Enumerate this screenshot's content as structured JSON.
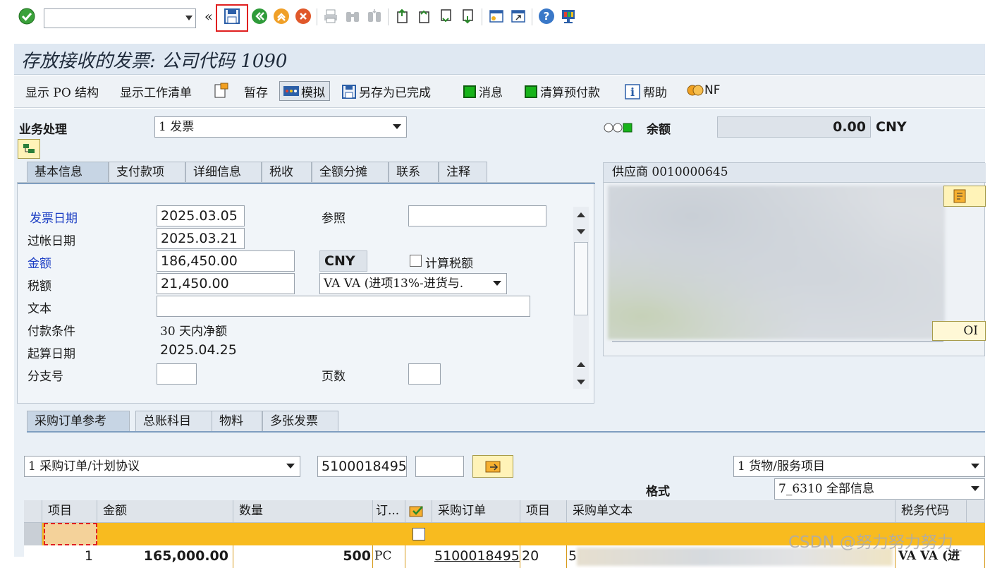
{
  "toolbar": {
    "command_field_value": "",
    "colors": {
      "save_highlight": "#e02020"
    }
  },
  "header": {
    "title": "存放接收的发票: 公司代码 1090"
  },
  "app_toolbar": {
    "show_po_structure": "显示 PO 结构",
    "show_worklist": "显示工作清单",
    "hold": "暂存",
    "simulate": "模拟",
    "save_completed": "另存为已完成",
    "messages": "消息",
    "clear_prepayment": "清算预付款",
    "help": "帮助",
    "nf": "NF"
  },
  "transaction": {
    "label": "业务处理",
    "value": "1 发票"
  },
  "balance": {
    "label": "余额",
    "value": "0.00",
    "currency": "CNY"
  },
  "tabs": [
    "基本信息",
    "支付款项",
    "详细信息",
    "税收",
    "全额分摊",
    "联系",
    "注释"
  ],
  "basic_data": {
    "invoice_date_label": "发票日期",
    "invoice_date": "2025.03.05",
    "reference_label": "参照",
    "reference": "",
    "posting_date_label": "过帐日期",
    "posting_date": "2025.03.21",
    "amount_label": "金额",
    "amount": "186,450.00",
    "currency": "CNY",
    "calc_tax_label": "计算税额",
    "tax_label": "税额",
    "tax_amount": "21,450.00",
    "tax_code": "VA VA (进项13%-进货与.",
    "text_label": "文本",
    "text": "",
    "payment_terms_label": "付款条件",
    "payment_terms": "30 天内净额",
    "baseline_date_label": "起算日期",
    "baseline_date": "2025.04.25",
    "branch_label": "分支号",
    "branch": "",
    "pages_label": "页数",
    "pages": ""
  },
  "vendor": {
    "header": "供应商 0010000645",
    "oi_label": "OI"
  },
  "po_tabs": [
    "采购订单参考",
    "总账科目",
    "物料",
    "多张发票"
  ],
  "po_reference": {
    "ref_type": "1 采购订单/计划协议",
    "po_number": "5100018495",
    "extra": "",
    "item_type": "1 货物/服务项目",
    "layout_label": "格式",
    "layout_value": "7_6310 全部信息"
  },
  "grid": {
    "columns": [
      "项目",
      "金额",
      "数量",
      "订...",
      "",
      "采购订单",
      "项目",
      "采购单文本",
      "税务代码"
    ],
    "rows": [
      {
        "item": "1",
        "amount": "165,000.00",
        "quantity": "500",
        "unit": "PC",
        "po": "5100018495",
        "po_item": "20",
        "po_text": "5",
        "tax_code": "VA VA (进"
      }
    ]
  },
  "watermark": "CSDN @努力努力努力_"
}
